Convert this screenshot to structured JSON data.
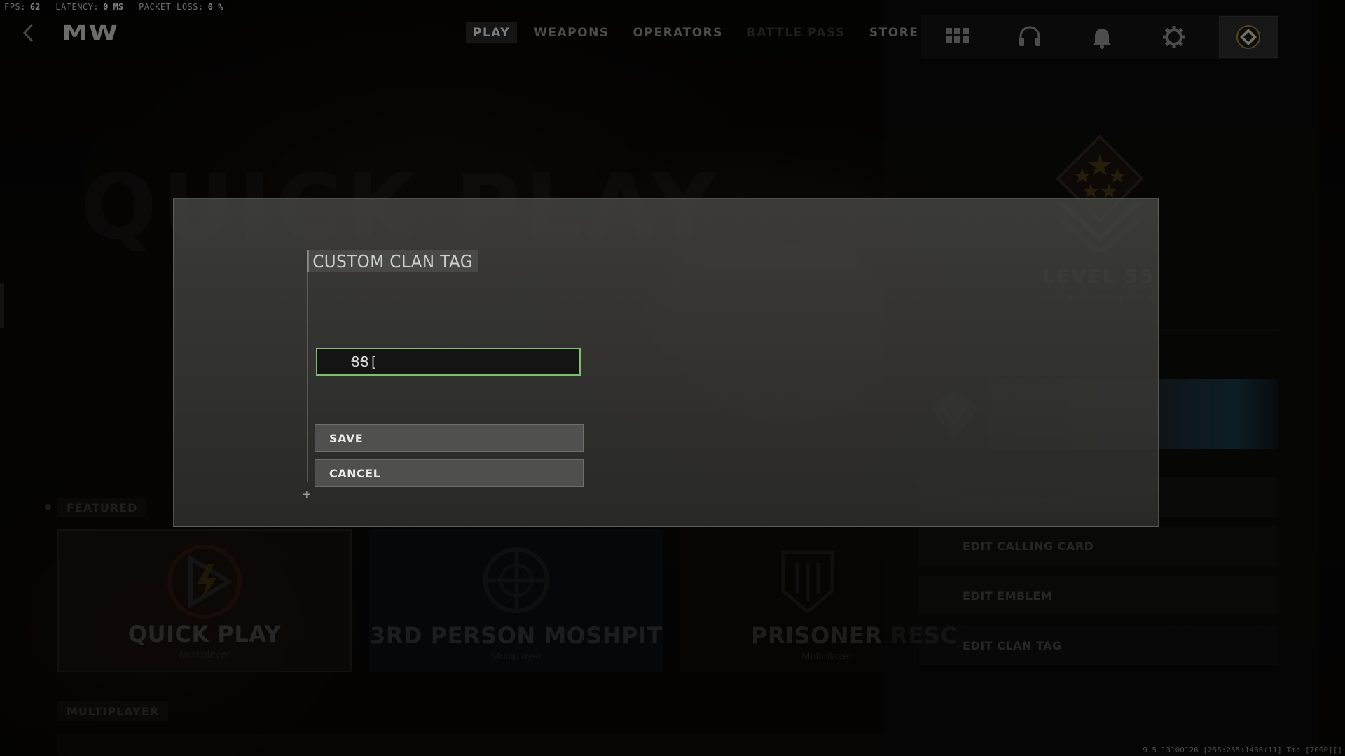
{
  "perf": {
    "fps_label": "FPS:",
    "fps_value": "62",
    "latency_label": "LATENCY:",
    "latency_value": "0 MS",
    "loss_label": "PACKET LOSS:",
    "loss_value": "0 %"
  },
  "header": {
    "logo": "MW",
    "tabs": [
      {
        "label": "PLAY",
        "state": "active"
      },
      {
        "label": "WEAPONS",
        "state": "normal"
      },
      {
        "label": "OPERATORS",
        "state": "normal"
      },
      {
        "label": "BATTLE PASS",
        "state": "dimmed"
      },
      {
        "label": "STORE",
        "state": "normal"
      }
    ],
    "icons": [
      "grid-icon",
      "headset-icon",
      "bell-icon",
      "gear-icon",
      "profile-emblem-icon"
    ]
  },
  "main": {
    "heading": "QUICK PLAY",
    "featured_label": "FEATURED",
    "multiplayer_label": "MULTIPLAYER",
    "modes": [
      {
        "title": "QUICK PLAY",
        "subtitle": "Multiplayer"
      },
      {
        "title": "3RD PERSON MOSHPIT",
        "subtitle": "Multiplayer"
      },
      {
        "title": "PRISONER RESC",
        "subtitle": "Multiplayer"
      }
    ]
  },
  "profile": {
    "level": "LEVEL 55",
    "rank_title": "Colonel Operator Tier V",
    "buttons": [
      {
        "label": "EDIT SHOWCASE",
        "state": "dimmed"
      },
      {
        "label": "EDIT CALLING CARD",
        "state": "normal"
      },
      {
        "label": "EDIT EMBLEM",
        "state": "normal"
      },
      {
        "label": "EDIT CLAN TAG",
        "state": "normal"
      }
    ]
  },
  "modal": {
    "title": "CUSTOM CLAN TAG",
    "input_value": "ՑՑ[",
    "save_label": "SAVE",
    "cancel_label": "CANCEL"
  },
  "colors": {
    "input_focus": "#7fbf6a",
    "active_tab_bg": "#2a2a2a"
  },
  "build_info": "9.5.13100126 [255:255:1466+11] Tmc [7000][]"
}
